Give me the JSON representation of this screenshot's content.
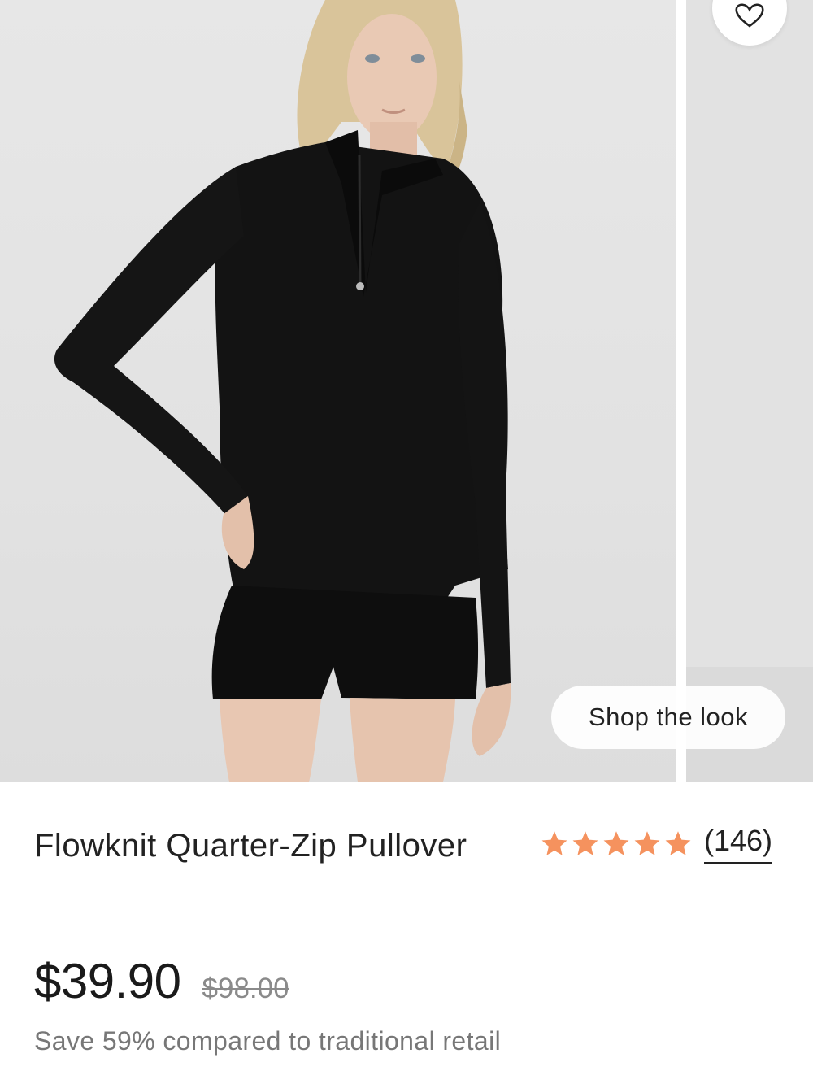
{
  "gallery": {
    "image_subject": "Model wearing black quarter-zip pullover and black shorts",
    "shop_look_label": "Shop the look",
    "favorite_icon": "heart-icon"
  },
  "product": {
    "title": "Flowknit Quarter-Zip Pullover",
    "rating": {
      "stars": 5,
      "star_icon": "star-icon",
      "star_color": "#f5925e",
      "review_count": "(146)"
    },
    "price_current": "$39.90",
    "price_original": "$98.00",
    "savings_text": "Save 59% compared to traditional retail"
  }
}
